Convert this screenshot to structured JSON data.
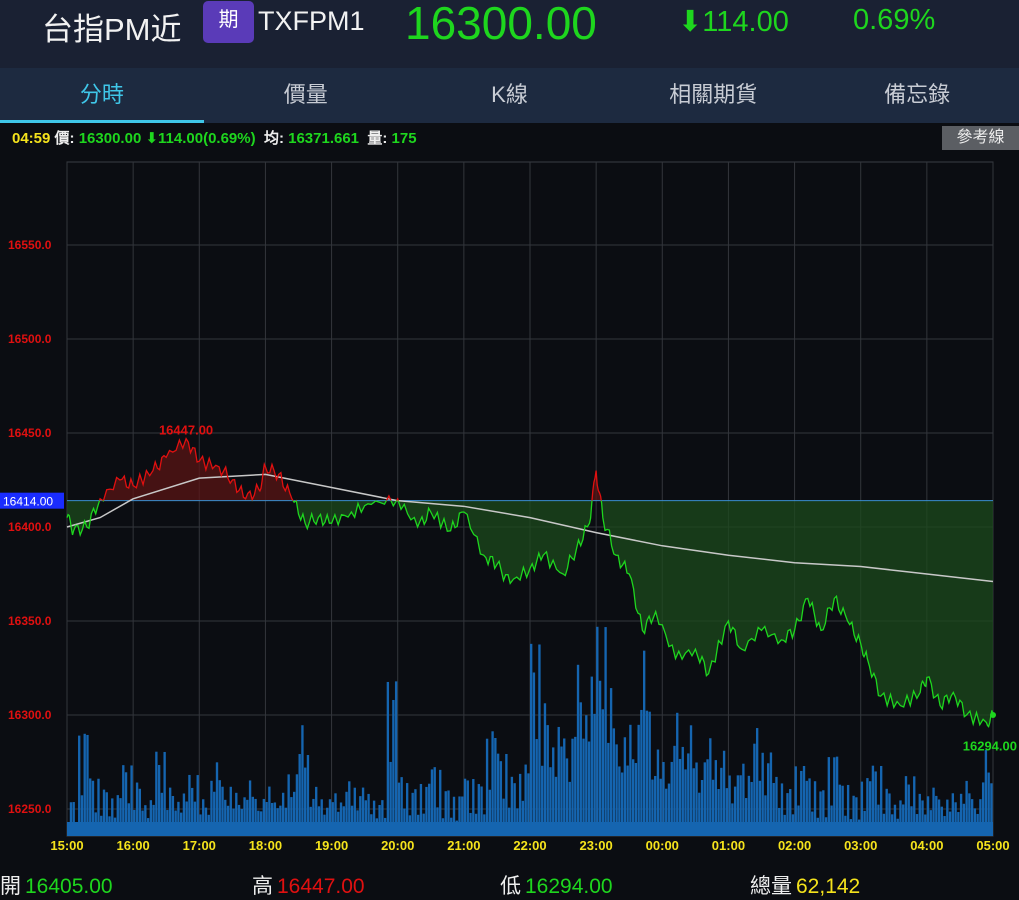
{
  "header": {
    "name": "台指PM近",
    "badge": "期",
    "code": "TXFPM1",
    "price": "16300.00",
    "change": "⬇114.00",
    "percent": "0.69%"
  },
  "tabs": [
    {
      "label": "分時",
      "active": true
    },
    {
      "label": "價量"
    },
    {
      "label": "K線"
    },
    {
      "label": "相關期貨"
    },
    {
      "label": "備忘錄"
    }
  ],
  "info": {
    "time": "04:59",
    "price_label": "價:",
    "price": "16300.00 ⬇114.00(0.69%)",
    "avg_label": "均:",
    "avg": "16371.661",
    "vol_label": "量:",
    "vol": "175",
    "ref_button": "參考線"
  },
  "footer": {
    "open_label": "開",
    "open": "16405.00",
    "high_label": "高",
    "high": "16447.00",
    "low_label": "低",
    "low": "16294.00",
    "total_label": "總量",
    "total": "62,142"
  },
  "colors": {
    "up": "#e01010",
    "down": "#1ed61e",
    "avg": "#c8c8c8",
    "volume": "#1565b0",
    "ref": "#3a8fd0"
  },
  "chart_data": {
    "type": "line",
    "ref_price": 16414,
    "ref_label": "16414.00",
    "high_label": "16447.00",
    "low_label": "16294.00",
    "ylim": [
      16222,
      16580
    ],
    "yticks": [
      16550,
      16500,
      16450,
      16400,
      16350,
      16300,
      16250
    ],
    "ytick_labels": [
      "16550.0",
      "16500.0",
      "16450.0",
      "16400.0",
      "16350.0",
      "16300.0",
      "16250.0"
    ],
    "xticks": [
      "15:00",
      "16:00",
      "17:00",
      "18:00",
      "19:00",
      "20:00",
      "21:00",
      "22:00",
      "23:00",
      "00:00",
      "01:00",
      "02:00",
      "03:00",
      "04:00",
      "05:00"
    ],
    "price": [
      [
        0,
        16405
      ],
      [
        0.1,
        16398
      ],
      [
        0.3,
        16400
      ],
      [
        0.5,
        16415
      ],
      [
        0.8,
        16425
      ],
      [
        1.0,
        16422
      ],
      [
        1.3,
        16430
      ],
      [
        1.5,
        16437
      ],
      [
        1.8,
        16447
      ],
      [
        2.0,
        16435
      ],
      [
        2.3,
        16432
      ],
      [
        2.5,
        16425
      ],
      [
        2.7,
        16415
      ],
      [
        2.9,
        16420
      ],
      [
        3.0,
        16432
      ],
      [
        3.2,
        16428
      ],
      [
        3.4,
        16415
      ],
      [
        3.6,
        16402
      ],
      [
        3.8,
        16405
      ],
      [
        4.0,
        16402
      ],
      [
        4.3,
        16408
      ],
      [
        4.6,
        16412
      ],
      [
        5.0,
        16415
      ],
      [
        5.3,
        16400
      ],
      [
        5.5,
        16408
      ],
      [
        5.8,
        16398
      ],
      [
        6.0,
        16408
      ],
      [
        6.3,
        16385
      ],
      [
        6.5,
        16380
      ],
      [
        6.7,
        16370
      ],
      [
        7.0,
        16378
      ],
      [
        7.2,
        16385
      ],
      [
        7.5,
        16375
      ],
      [
        7.7,
        16388
      ],
      [
        7.9,
        16402
      ],
      [
        8.0,
        16430
      ],
      [
        8.1,
        16405
      ],
      [
        8.3,
        16385
      ],
      [
        8.5,
        16375
      ],
      [
        8.7,
        16345
      ],
      [
        8.9,
        16355
      ],
      [
        9.2,
        16330
      ],
      [
        9.5,
        16335
      ],
      [
        9.7,
        16322
      ],
      [
        10.0,
        16350
      ],
      [
        10.2,
        16335
      ],
      [
        10.5,
        16345
      ],
      [
        10.8,
        16340
      ],
      [
        11.0,
        16345
      ],
      [
        11.2,
        16362
      ],
      [
        11.4,
        16345
      ],
      [
        11.6,
        16362
      ],
      [
        11.8,
        16350
      ],
      [
        12.0,
        16338
      ],
      [
        12.1,
        16330
      ],
      [
        12.3,
        16310
      ],
      [
        12.6,
        16305
      ],
      [
        12.9,
        16312
      ],
      [
        13.0,
        16320
      ],
      [
        13.2,
        16305
      ],
      [
        13.4,
        16312
      ],
      [
        13.6,
        16300
      ],
      [
        13.9,
        16296
      ],
      [
        14.0,
        16300
      ]
    ],
    "avg": [
      [
        0,
        16400
      ],
      [
        0.5,
        16405
      ],
      [
        1.0,
        16415
      ],
      [
        2.0,
        16426
      ],
      [
        3.0,
        16428
      ],
      [
        4.0,
        16421
      ],
      [
        5.0,
        16414
      ],
      [
        6.0,
        16411
      ],
      [
        7.0,
        16405
      ],
      [
        8.0,
        16397
      ],
      [
        9.0,
        16390
      ],
      [
        10.0,
        16385
      ],
      [
        11.0,
        16381
      ],
      [
        12.0,
        16379
      ],
      [
        13.0,
        16375
      ],
      [
        14.0,
        16371
      ]
    ],
    "volume": [
      300,
      900,
      500,
      400,
      350,
      600,
      450,
      300,
      700,
      400,
      350,
      500,
      300,
      600,
      400,
      350,
      450,
      300,
      400,
      350,
      500,
      900,
      400,
      300,
      350,
      450,
      400,
      350,
      300,
      1300,
      500,
      400,
      450,
      600,
      400,
      350,
      500,
      450,
      900,
      700,
      500,
      600,
      1600,
      1100,
      900,
      800,
      1400,
      1300,
      1700,
      1200,
      800,
      900,
      1500,
      700,
      600,
      1000,
      900,
      600,
      800,
      700,
      500,
      600,
      900,
      700,
      500,
      400,
      600,
      500,
      400,
      700,
      450,
      350,
      500,
      600,
      400,
      300,
      500,
      350,
      400,
      300,
      350,
      450,
      300,
      700
    ]
  }
}
